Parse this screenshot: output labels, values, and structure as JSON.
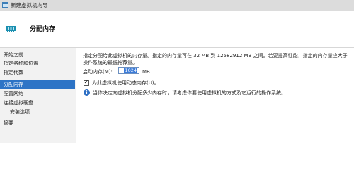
{
  "window": {
    "title": "新建虚拟机向导",
    "icon": "window-app-icon"
  },
  "header": {
    "title": "分配内存",
    "icon": "memory-chip-icon"
  },
  "nav": {
    "items": [
      {
        "label": "开始之前",
        "active": false,
        "sub": false
      },
      {
        "label": "指定名称和位置",
        "active": false,
        "sub": false
      },
      {
        "label": "指定代数",
        "active": false,
        "sub": false
      },
      {
        "label": "分配内存",
        "active": true,
        "sub": false
      },
      {
        "label": "配置网络",
        "active": false,
        "sub": false
      },
      {
        "label": "连接虚拟硬盘",
        "active": false,
        "sub": false
      },
      {
        "label": "安装选项",
        "active": false,
        "sub": true
      },
      {
        "label": "摘要",
        "active": false,
        "sub": false
      }
    ]
  },
  "main": {
    "description": "指定分配给此虚拟机的内存量。指定的内存量可在 32 MB 到 12582912 MB 之间。若要提高性能，指定的内存量应大于操作系统的最低推荐量。",
    "startup_memory": {
      "label": "启动内存(M):",
      "value": "1024",
      "unit": "MB"
    },
    "dynamic_memory": {
      "label": "为此虚拟机使用动态内存(U)。",
      "checked": true
    },
    "info": {
      "text": "当你决定向虚拟机分配多少内存时，请考虑你要使用虚拟机的方式及它运行的操作系统。",
      "icon": "info-icon"
    }
  },
  "colors": {
    "accent": "#2d74c6",
    "nav_bg": "#f2f2f2",
    "header_icon": "#1a8fb0"
  }
}
